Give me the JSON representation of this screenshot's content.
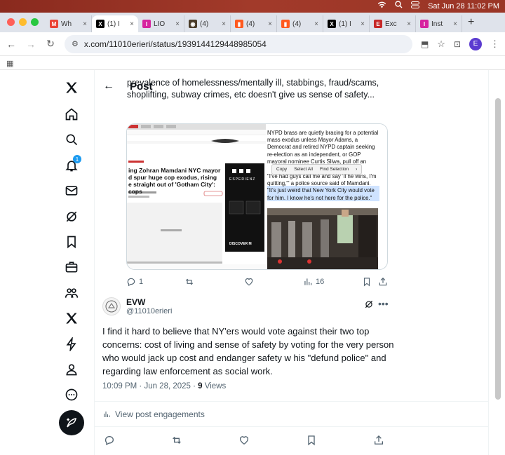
{
  "menubar": {
    "datetime": "Sat Jun 28  11:02 PM"
  },
  "tabs": [
    {
      "label": "Wh",
      "fav": "M",
      "color": "#ea4335"
    },
    {
      "label": "(1) I",
      "fav": "X",
      "color": "#000000",
      "active": true
    },
    {
      "label": "LIO",
      "fav": "I",
      "color": "#d6249f"
    },
    {
      "label": "(4)",
      "fav": "◉",
      "color": "#4a3c2a"
    },
    {
      "label": "(4)",
      "fav": "▮",
      "color": "#ff5a1f"
    },
    {
      "label": "(4)",
      "fav": "▮",
      "color": "#ff5a1f"
    },
    {
      "label": "(1) I",
      "fav": "X",
      "color": "#000000"
    },
    {
      "label": "Exc",
      "fav": "E",
      "color": "#c62828"
    },
    {
      "label": "Inst",
      "fav": "I",
      "color": "#d6249f"
    }
  ],
  "browser": {
    "url": "x.com/11010erieri/status/1939144129448985054",
    "profile_initial": "E"
  },
  "header": {
    "title": "Post"
  },
  "notifications_badge": "1",
  "quoted": {
    "text": "prevalence of homelessness/mentally ill, stabbings, fraud/scams, shoplifting, subway crimes, etc doesn't give us sense of safety...",
    "article": {
      "headline_lines": [
        "ing Zohran Mamdani NYC mayor",
        "d spur huge cop exodus, rising",
        "e straight out of 'Gotham City': cops"
      ],
      "ad_brand": "ESPERIENZ",
      "ad_cta": "DISCOVER M",
      "right_text": "NYPD brass are quietly bracing for a potential mass exodus unless Mayor Adams, a Democrat and retired NYPD captain seeking re-election as an independent, or GOP mayoral nominee Curtis Sliwa, pull off an upset.",
      "right_quote": "\"I've had guys call me and say 'if he wins, I'm quitting,'\" a police source said of Mamdani. \"It's just weird that New York City would vote for him. I know he's not here for the police.\"",
      "context_menu": [
        "Copy",
        "Select All",
        "Find Selection"
      ]
    },
    "actions": {
      "replies": "1",
      "views": "16"
    }
  },
  "post": {
    "author_name": "EVW",
    "author_handle": "@11010erieri",
    "text": "I find it hard to believe that NY'ers would vote against their two top concerns: cost of living and sense of safety by voting for the very person who would jack up cost and endanger safety w his \"defund police\" and regarding law enforcement as social work.",
    "time": "10:09 PM · Jun 28, 2025 · ",
    "views_count": "9",
    "views_label": " Views",
    "engagements_label": "View post engagements"
  }
}
